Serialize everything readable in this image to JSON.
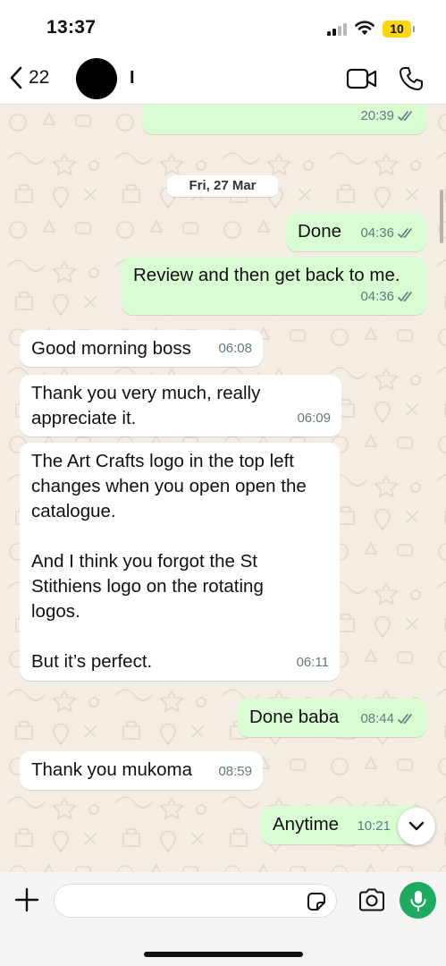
{
  "status_bar": {
    "time": "13:37",
    "battery": "10",
    "signal_icon": "cellular-signal-icon",
    "wifi_icon": "wifi-icon"
  },
  "header": {
    "back_count": "22",
    "contact_name": "I",
    "icons": [
      "chevron-left-icon",
      "video-camera-icon",
      "phone-icon"
    ]
  },
  "chat": {
    "date_separator": "Fri, 27 Mar",
    "messages": [
      {
        "direction": "out",
        "text": "",
        "time": "20:39",
        "read": true
      },
      {
        "direction": "out",
        "text": "Done",
        "time": "04:36",
        "read": true
      },
      {
        "direction": "out",
        "text": "Review and then get back to me.",
        "time": "04:36",
        "read": true
      },
      {
        "direction": "in",
        "text": "Good morning boss",
        "time": "06:08"
      },
      {
        "direction": "in",
        "text": "Thank you very much, really\nappreciate it.",
        "time": "06:09"
      },
      {
        "direction": "in",
        "text": "The Art Crafts logo in the top left\nchanges when you open open the\ncatalogue.\n\nAnd I think you forgot the St\nStithiens logo on the rotating\nlogos.\n\nBut it’s perfect.",
        "time": "06:11"
      },
      {
        "direction": "out",
        "text": "Done baba",
        "time": "08:44",
        "read": true
      },
      {
        "direction": "in",
        "text": "Thank you mukoma",
        "time": "08:59"
      },
      {
        "direction": "out",
        "text": "Anytime",
        "time": "10:21",
        "read": true
      }
    ]
  },
  "composer": {
    "placeholder": "",
    "icons": [
      "plus-icon",
      "sticker-icon",
      "camera-icon",
      "microphone-icon"
    ]
  },
  "colors": {
    "outgoing_bubble": "#d9fdd3",
    "incoming_bubble": "#ffffff",
    "wallpaper": "#f3ede4",
    "accent_green": "#1daa61",
    "read_ticks": "#667781"
  }
}
